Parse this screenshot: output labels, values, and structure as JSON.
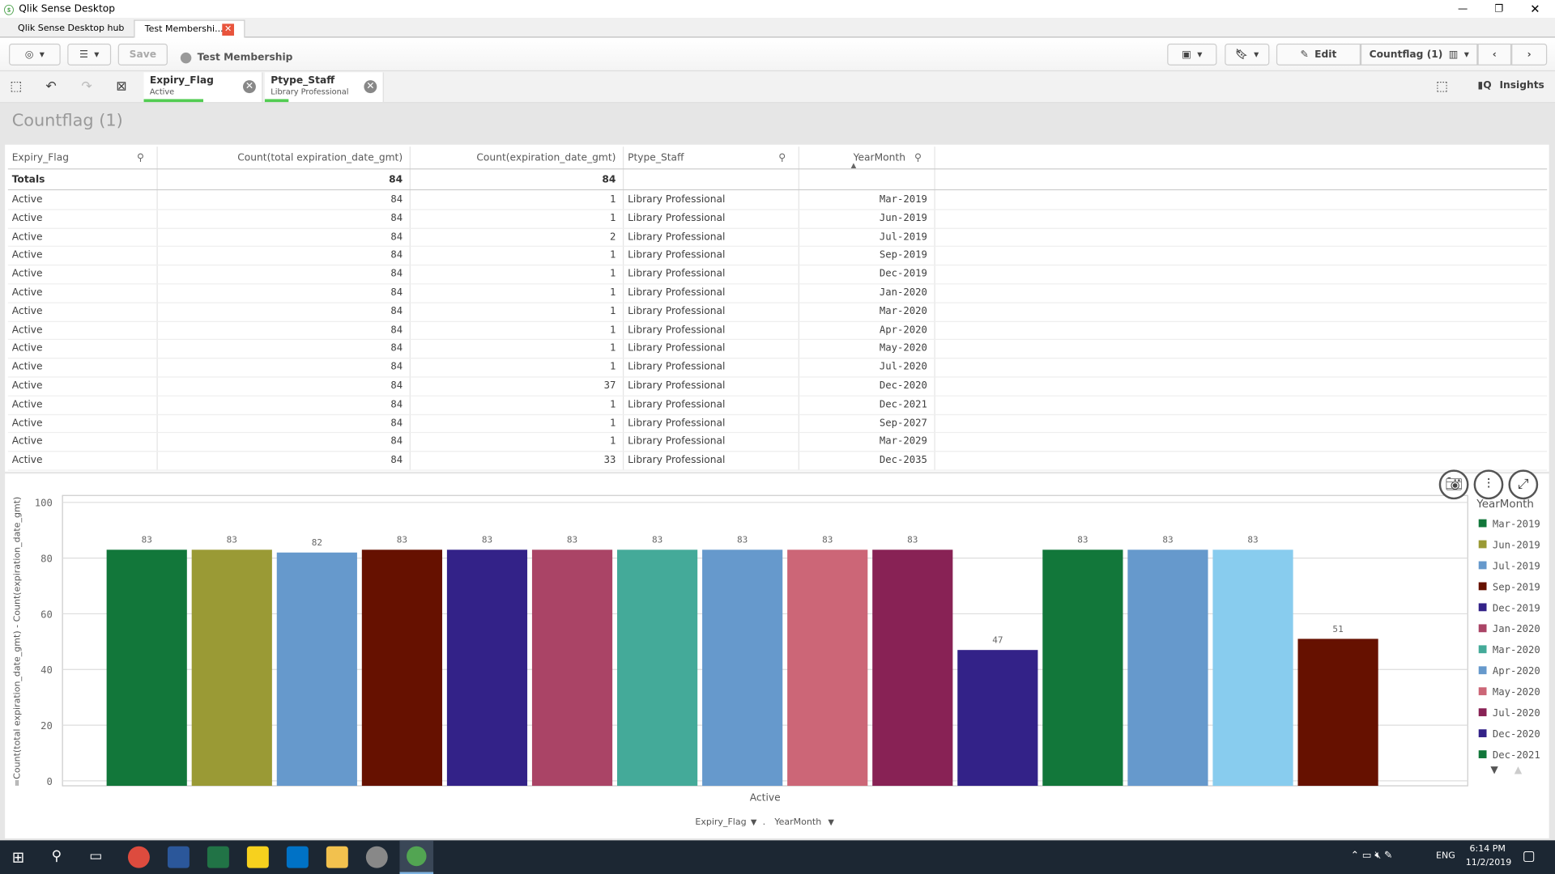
{
  "window": {
    "title": "Qlik Sense Desktop",
    "tabs": [
      "Qlik Sense Desktop hub",
      "Test Membershi..."
    ]
  },
  "toolbar": {
    "save_label": "Save",
    "app_name": "Test Membership",
    "edit_label": "Edit",
    "sheet_name": "Countflag (1)",
    "insights_label": "Insights"
  },
  "selections": [
    {
      "field": "Expiry_Flag",
      "value": "Active"
    },
    {
      "field": "Ptype_Staff",
      "value": "Library Professional"
    }
  ],
  "sheet": {
    "title": "Countflag (1)"
  },
  "table": {
    "headers": [
      "Expiry_Flag",
      "Count(total expiration_date_gmt)",
      "Count(expiration_date_gmt)",
      "Ptype_Staff",
      "YearMonth"
    ],
    "totals": {
      "label": "Totals",
      "total": "84",
      "count": "84"
    },
    "rows": [
      [
        "Active",
        "84",
        "1",
        "Library Professional",
        "Mar-2019"
      ],
      [
        "Active",
        "84",
        "1",
        "Library Professional",
        "Jun-2019"
      ],
      [
        "Active",
        "84",
        "2",
        "Library Professional",
        "Jul-2019"
      ],
      [
        "Active",
        "84",
        "1",
        "Library Professional",
        "Sep-2019"
      ],
      [
        "Active",
        "84",
        "1",
        "Library Professional",
        "Dec-2019"
      ],
      [
        "Active",
        "84",
        "1",
        "Library Professional",
        "Jan-2020"
      ],
      [
        "Active",
        "84",
        "1",
        "Library Professional",
        "Mar-2020"
      ],
      [
        "Active",
        "84",
        "1",
        "Library Professional",
        "Apr-2020"
      ],
      [
        "Active",
        "84",
        "1",
        "Library Professional",
        "May-2020"
      ],
      [
        "Active",
        "84",
        "1",
        "Library Professional",
        "Jul-2020"
      ],
      [
        "Active",
        "84",
        "37",
        "Library Professional",
        "Dec-2020"
      ],
      [
        "Active",
        "84",
        "1",
        "Library Professional",
        "Dec-2021"
      ],
      [
        "Active",
        "84",
        "1",
        "Library Professional",
        "Sep-2027"
      ],
      [
        "Active",
        "84",
        "1",
        "Library Professional",
        "Mar-2029"
      ],
      [
        "Active",
        "84",
        "33",
        "Library Professional",
        "Dec-2035"
      ]
    ]
  },
  "chart_data": {
    "type": "bar",
    "ylabel": "=Count(total expiration_date_gmt) - Count(expiration_date_gmt)",
    "xcategory": "Active",
    "ylim": [
      0,
      100
    ],
    "yticks": [
      0,
      20,
      40,
      60,
      80,
      100
    ],
    "grid": true,
    "legend_title": "YearMonth",
    "legend_position": "right",
    "categories": [
      "Mar-2019",
      "Jun-2019",
      "Jul-2019",
      "Sep-2019",
      "Dec-2019",
      "Jan-2020",
      "Mar-2020",
      "Apr-2020",
      "May-2020",
      "Jul-2020",
      "Dec-2020",
      "Dec-2021",
      "Sep-2027",
      "Mar-2029",
      "Dec-2035"
    ],
    "values": [
      83,
      83,
      82,
      83,
      83,
      83,
      83,
      83,
      83,
      83,
      47,
      83,
      83,
      83,
      51
    ],
    "colors": [
      "#12773a",
      "#9a9a35",
      "#6699cc",
      "#661100",
      "#332288",
      "#aa4466",
      "#44aa99",
      "#6699cc",
      "#cc6677",
      "#882255",
      "#332288",
      "#12773a",
      "#6699cc",
      "#88ccee",
      "#661100"
    ],
    "legend_visible": [
      "Mar-2019",
      "Jun-2019",
      "Jul-2019",
      "Sep-2019",
      "Dec-2019",
      "Jan-2020",
      "Mar-2020",
      "Apr-2020",
      "May-2020",
      "Jul-2020",
      "Dec-2020",
      "Dec-2021"
    ],
    "dimension_pickers": [
      "Expiry_Flag",
      "YearMonth"
    ]
  },
  "taskbar": {
    "lang": "ENG",
    "time": "6:14 PM",
    "date": "11/2/2019"
  }
}
